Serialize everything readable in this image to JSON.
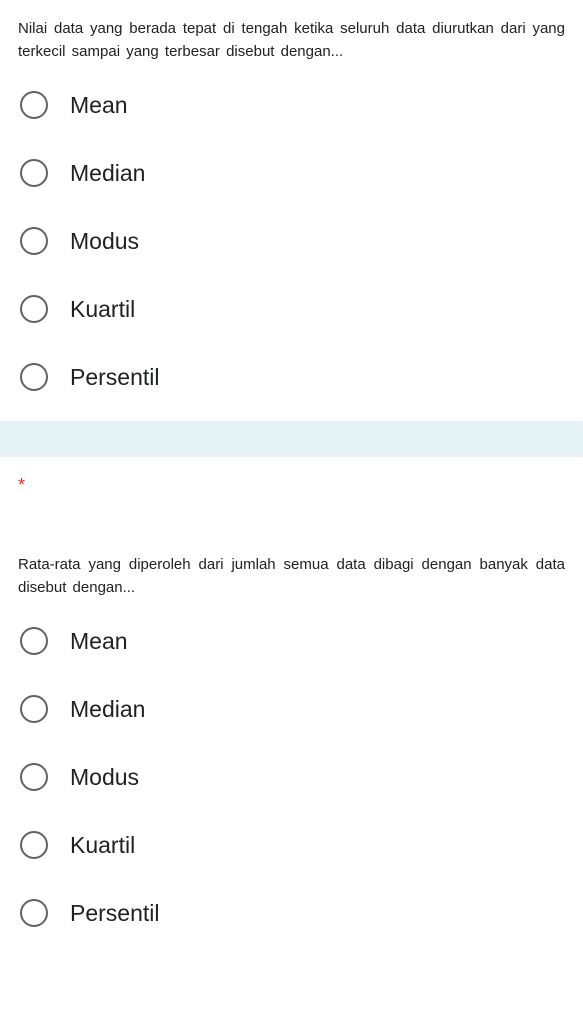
{
  "questions": [
    {
      "text": "Nilai data yang berada tepat  di tengah ketika seluruh data diurutkan dari yang terkecil sampai yang terbesar disebut dengan...",
      "required": false,
      "options": [
        "Mean",
        "Median",
        "Modus",
        "Kuartil",
        "Persentil"
      ]
    },
    {
      "text": "Rata-rata yang diperoleh dari jumlah semua data dibagi dengan banyak data disebut dengan...",
      "required": true,
      "options": [
        "Mean",
        "Median",
        "Modus",
        "Kuartil",
        "Persentil"
      ]
    }
  ],
  "required_marker": "*"
}
